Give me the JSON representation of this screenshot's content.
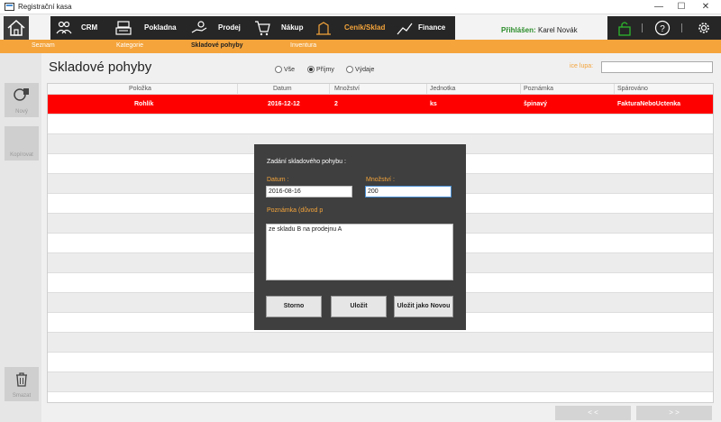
{
  "window": {
    "title": "Registrační kasa",
    "minimize_icon": "minimize-icon",
    "maximize_icon": "maximize-icon",
    "close_icon": "close-icon"
  },
  "nav": {
    "items": [
      {
        "label": "CRM",
        "icon": "crm-people-icon"
      },
      {
        "label": "Pokladna",
        "icon": "cash-register-icon"
      },
      {
        "label": "Prodej",
        "icon": "sale-hand-icon"
      },
      {
        "label": "Nákup",
        "icon": "cart-icon"
      },
      {
        "label": "Ceník/Sklad",
        "icon": "warehouse-icon",
        "active": true
      },
      {
        "label": "Finance",
        "icon": "finance-icon"
      }
    ]
  },
  "login": {
    "label": "Přihlášen:",
    "user": "Karel Novák"
  },
  "subnav": {
    "items": [
      {
        "label": "Seznam"
      },
      {
        "label": "Kategorie"
      },
      {
        "label": "Skladové pohyby",
        "active": true
      },
      {
        "label": "Inventura"
      }
    ]
  },
  "sidebar": {
    "new_label": "Nový",
    "copy_label": "Kopírovat",
    "delete_label": "Smazat"
  },
  "page": {
    "title": "Skladové pohyby",
    "filters": [
      {
        "label": "Vše",
        "selected": false
      },
      {
        "label": "Příjmy",
        "selected": true
      },
      {
        "label": "Výdaje",
        "selected": false
      }
    ],
    "search_label": "ice lupa:",
    "search_value": ""
  },
  "table": {
    "columns": [
      "Položka",
      "Datum",
      "Množství",
      "Jednotka",
      "Poznámka",
      "Spárováno"
    ],
    "rows": [
      {
        "polozka": "Rohlík",
        "datum": "2016-12-12",
        "mnozstvi": "2",
        "jednotka": "ks",
        "poznamka": "špinavý",
        "sparovano": "FakturaNeboUctenka"
      }
    ]
  },
  "dialog": {
    "title": "Zadání skladového pohybu :",
    "date_label": "Datum :",
    "date_value": "2016-08-16",
    "qty_label": "Množství :",
    "qty_value": "200",
    "note_label": "Poznámka (důvod p",
    "note_value": "ze skladu B na prodejnu A",
    "cancel_label": "Storno",
    "save_label": "Uložit",
    "save_new_label": "Uložit jako Novou"
  },
  "pager": {
    "prev_label": "< <",
    "next_label": "> >"
  },
  "colors": {
    "accent": "#f4a43b",
    "selected_row": "#ff0000",
    "nav_bg": "#262626",
    "login": "#2a8c2a"
  }
}
